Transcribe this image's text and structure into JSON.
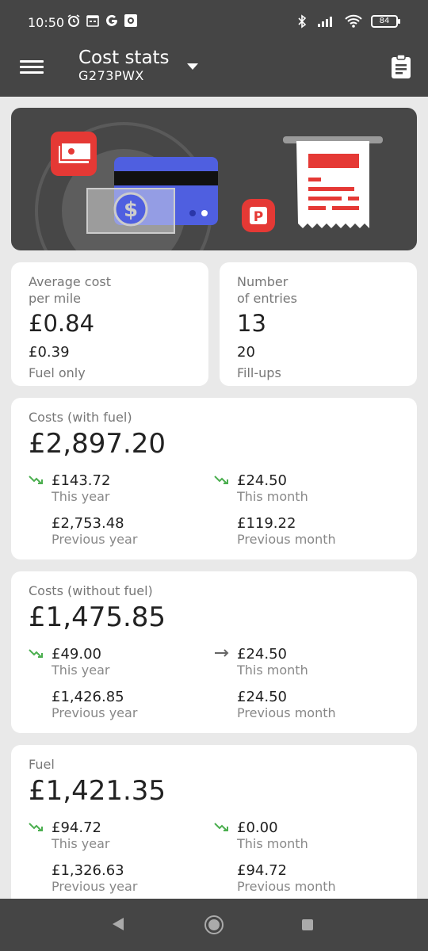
{
  "status_bar": {
    "time": "10:50",
    "left_icons": [
      "alarm-icon",
      "calendar-icon",
      "google-icon",
      "screenshot-icon"
    ],
    "right_icons": [
      "bluetooth-icon",
      "signal-icon",
      "wifi-icon"
    ],
    "battery": "84"
  },
  "app_bar": {
    "title": "Cost stats",
    "subtitle": "G273PWX",
    "menu_icon": "menu-icon",
    "dropdown_icon": "chevron-down-icon",
    "action_icon": "clipboard-icon"
  },
  "banner": {
    "illustration": "cost-illustration",
    "colors": {
      "background": "#474747",
      "accent_red": "#e53935",
      "card_blue": "#4f5fe0"
    }
  },
  "summary": {
    "avg_cost": {
      "label": "Average cost\nper mile",
      "value": "£0.84",
      "sub_value": "£0.39",
      "sub_caption": "Fuel only"
    },
    "entries": {
      "label": "Number\nof entries",
      "value": "13",
      "sub_value": "20",
      "sub_caption": "Fill-ups"
    }
  },
  "sections": [
    {
      "label": "Costs (with fuel)",
      "total": "£2,897.20",
      "this_year": {
        "trend": "down",
        "amount": "£143.72",
        "caption": "This year"
      },
      "this_month": {
        "trend": "down",
        "amount": "£24.50",
        "caption": "This month"
      },
      "previous_year": {
        "amount": "£2,753.48",
        "caption": "Previous year"
      },
      "previous_month": {
        "amount": "£119.22",
        "caption": "Previous month"
      }
    },
    {
      "label": "Costs (without fuel)",
      "total": "£1,475.85",
      "this_year": {
        "trend": "down",
        "amount": "£49.00",
        "caption": "This year"
      },
      "this_month": {
        "trend": "flat",
        "amount": "£24.50",
        "caption": "This month"
      },
      "previous_year": {
        "amount": "£1,426.85",
        "caption": "Previous year"
      },
      "previous_month": {
        "amount": "£24.50",
        "caption": "Previous month"
      }
    },
    {
      "label": "Fuel",
      "total": "£1,421.35",
      "this_year": {
        "trend": "down",
        "amount": "£94.72",
        "caption": "This year"
      },
      "this_month": {
        "trend": "down",
        "amount": "£0.00",
        "caption": "This month"
      },
      "previous_year": {
        "amount": "£1,326.63",
        "caption": "Previous year"
      },
      "previous_month": {
        "amount": "£94.72",
        "caption": "Previous month"
      }
    }
  ],
  "colors": {
    "bar": "#454545",
    "trend_down": "#4caf50",
    "trend_flat": "#666666"
  },
  "nav_bar": {
    "icons": [
      "back-icon",
      "home-icon",
      "recents-icon"
    ]
  }
}
